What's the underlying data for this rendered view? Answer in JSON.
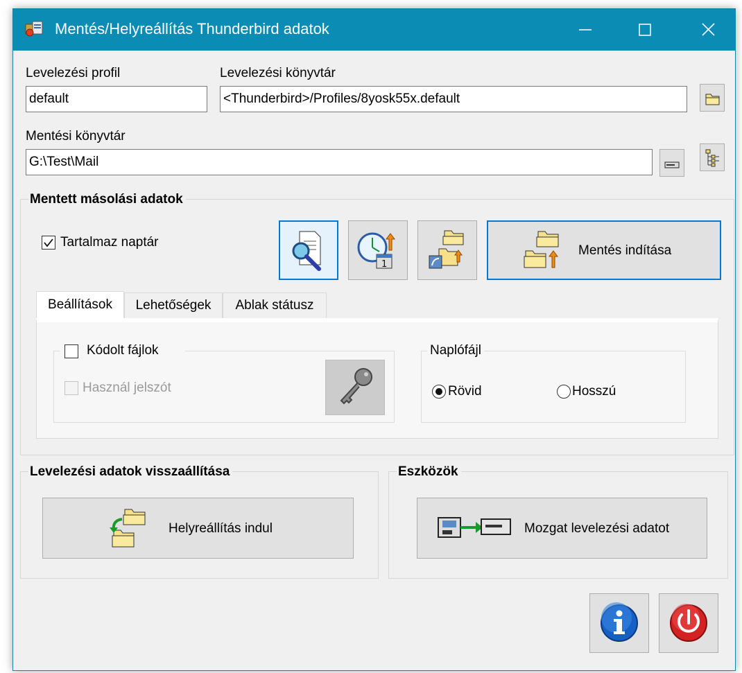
{
  "window": {
    "title": "Mentés/Helyreállítás Thunderbird adatok",
    "controls": {
      "minimize": "—",
      "maximize": "☐",
      "close": "✕"
    }
  },
  "profile": {
    "profile_label": "Levelezési profil",
    "profile_value": "default",
    "mail_dir_label": "Levelezési könyvtár",
    "mail_dir_value": "<Thunderbird>/Profiles/8yosk55x.default"
  },
  "backup_dir": {
    "label": "Mentési könyvtár",
    "value": "G:\\Test\\Mail"
  },
  "backup_group": {
    "title": "Mentett másolási adatok",
    "include_calendar_label": "Tartalmaz naptár",
    "include_calendar_checked": true,
    "start_backup_label": "Mentés indítása",
    "tabs": [
      "Beállítások",
      "Lehetőségek",
      "Ablak státusz"
    ],
    "active_tab": 0,
    "encrypted_files_label": "Kódolt fájlok",
    "encrypted_files_checked": false,
    "use_password_label": "Használ jelszót",
    "use_password_enabled": false,
    "logfile": {
      "title": "Naplófájl",
      "options": [
        "Rövid",
        "Hosszú"
      ],
      "selected": "Rövid"
    }
  },
  "restore_group": {
    "title": "Levelezési adatok visszaállítása",
    "button_label": "Helyreállítás indul"
  },
  "tools_group": {
    "title": "Eszközök",
    "button_label": "Mozgat levelezési adatot"
  },
  "colors": {
    "titlebar": "#0a8cb4",
    "window_bg": "#f0f0f0",
    "button_bg": "#e1e1e1",
    "focus_border": "#0078d7",
    "info_blue": "#1560c4",
    "power_red": "#d22222"
  },
  "icons": [
    "app-icon",
    "folder-icon",
    "drive-icon",
    "tree-icon",
    "search-document-icon",
    "calendar-clock-icon",
    "folder-sync-icon",
    "backup-folders-icon",
    "key-icon",
    "restore-folders-icon",
    "move-data-icon",
    "info-icon",
    "power-icon"
  ]
}
